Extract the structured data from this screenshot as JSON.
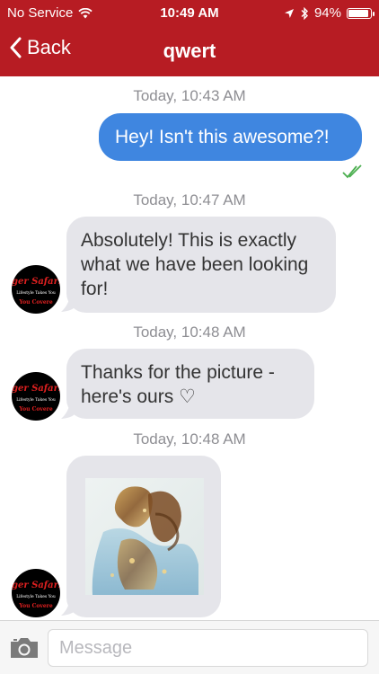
{
  "status_bar": {
    "carrier": "No Service",
    "time": "10:49 AM",
    "battery_percent": "94%",
    "battery_level": 0.94,
    "icons": [
      "wifi-icon",
      "location-arrow-icon",
      "bluetooth-icon",
      "battery-icon"
    ]
  },
  "nav": {
    "back_label": "Back",
    "title": "qwert"
  },
  "messages": [
    {
      "kind": "timestamp",
      "text": "Today, 10:43 AM"
    },
    {
      "kind": "outgoing",
      "text": "Hey!  Isn't this awesome?!",
      "status": "read-double-check"
    },
    {
      "kind": "timestamp",
      "text": "Today, 10:47 AM"
    },
    {
      "kind": "incoming",
      "lines": [
        "Absolutely!  This is exactly",
        "what we have been looking",
        "for!"
      ]
    },
    {
      "kind": "timestamp",
      "text": "Today, 10:48 AM"
    },
    {
      "kind": "incoming",
      "lines": [
        "Thanks for the picture -",
        "here's ours ♡"
      ]
    },
    {
      "kind": "timestamp",
      "text": "Today, 10:48 AM"
    },
    {
      "kind": "incoming-image"
    }
  ],
  "avatar_text": {
    "line1": "ger Safari",
    "line2": "Lifestyle Takes You",
    "line3": "You Covere"
  },
  "composer": {
    "placeholder": "Message"
  },
  "colors": {
    "header_red": "#b71c23",
    "outgoing_bubble": "#3f86e0",
    "incoming_bubble": "#e5e5ea",
    "read_check_green": "#4caf50",
    "timestamp_gray": "#8e8e93"
  }
}
